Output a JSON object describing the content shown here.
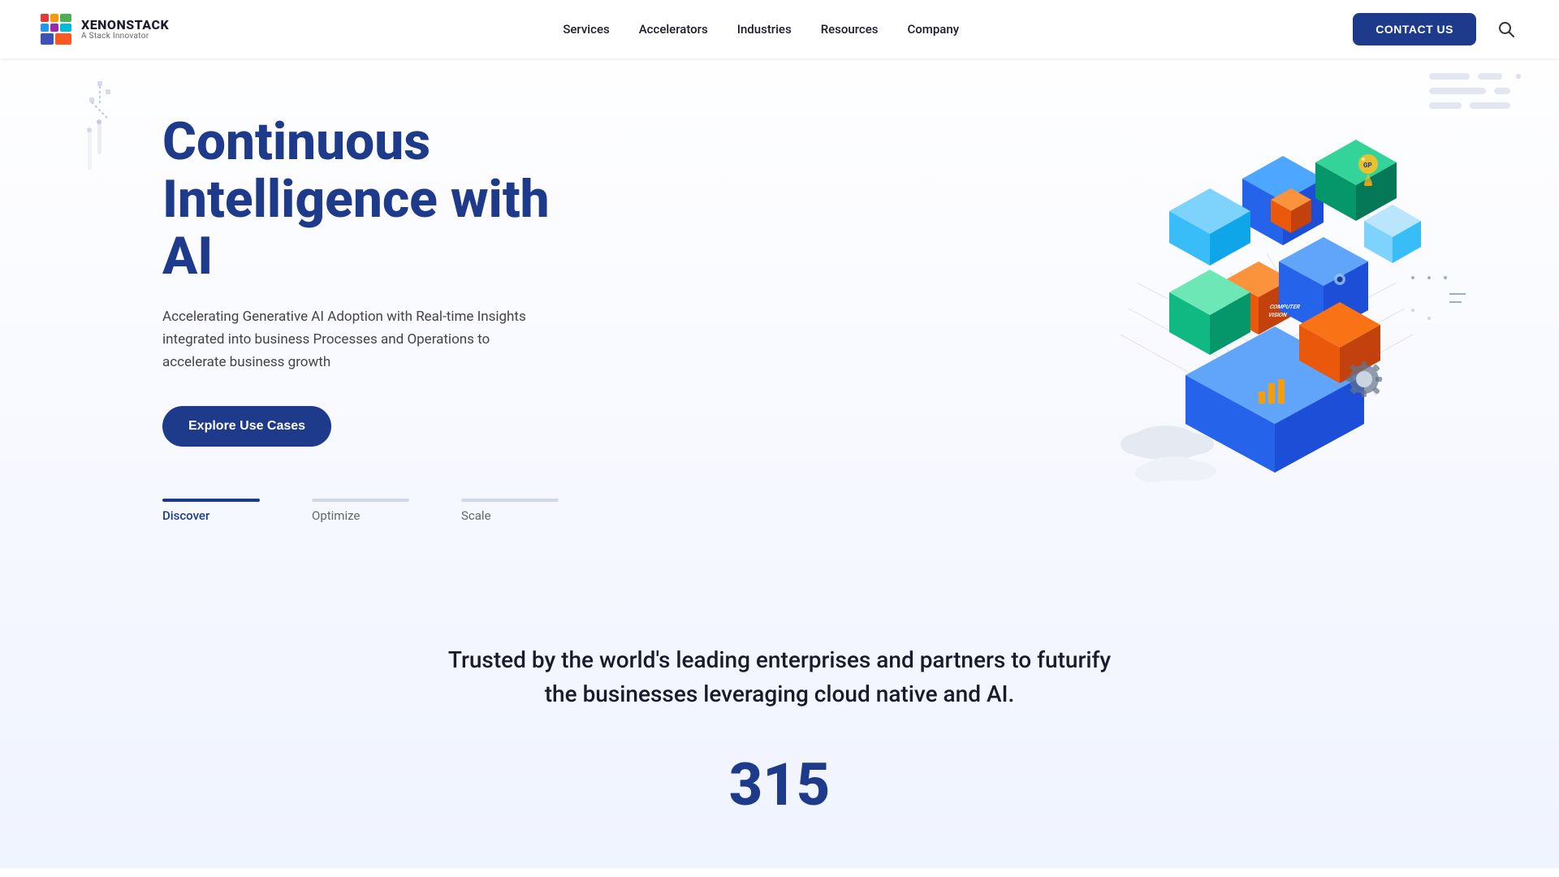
{
  "nav": {
    "logo": {
      "name": "XENONSTACK",
      "sub": "A Stack Innovator"
    },
    "links": [
      {
        "label": "Services",
        "id": "services"
      },
      {
        "label": "Accelerators",
        "id": "accelerators"
      },
      {
        "label": "Industries",
        "id": "industries"
      },
      {
        "label": "Resources",
        "id": "resources"
      },
      {
        "label": "Company",
        "id": "company"
      }
    ],
    "contact_button": "CONTACT US"
  },
  "hero": {
    "title_line1": "Continuous",
    "title_line2": "Intelligence with AI",
    "description": "Accelerating Generative AI Adoption with Real-time Insights integrated into business Processes and Operations to accelerate business growth",
    "cta_button": "Explore Use Cases",
    "tabs": [
      {
        "label": "Discover",
        "active": true
      },
      {
        "label": "Optimize",
        "active": false
      },
      {
        "label": "Scale",
        "active": false
      }
    ]
  },
  "trusted": {
    "heading": "Trusted by the world's leading enterprises and partners to futurify the businesses leveraging cloud native and AI.",
    "stat_preview": "315"
  },
  "icons": {
    "search": "🔍"
  }
}
